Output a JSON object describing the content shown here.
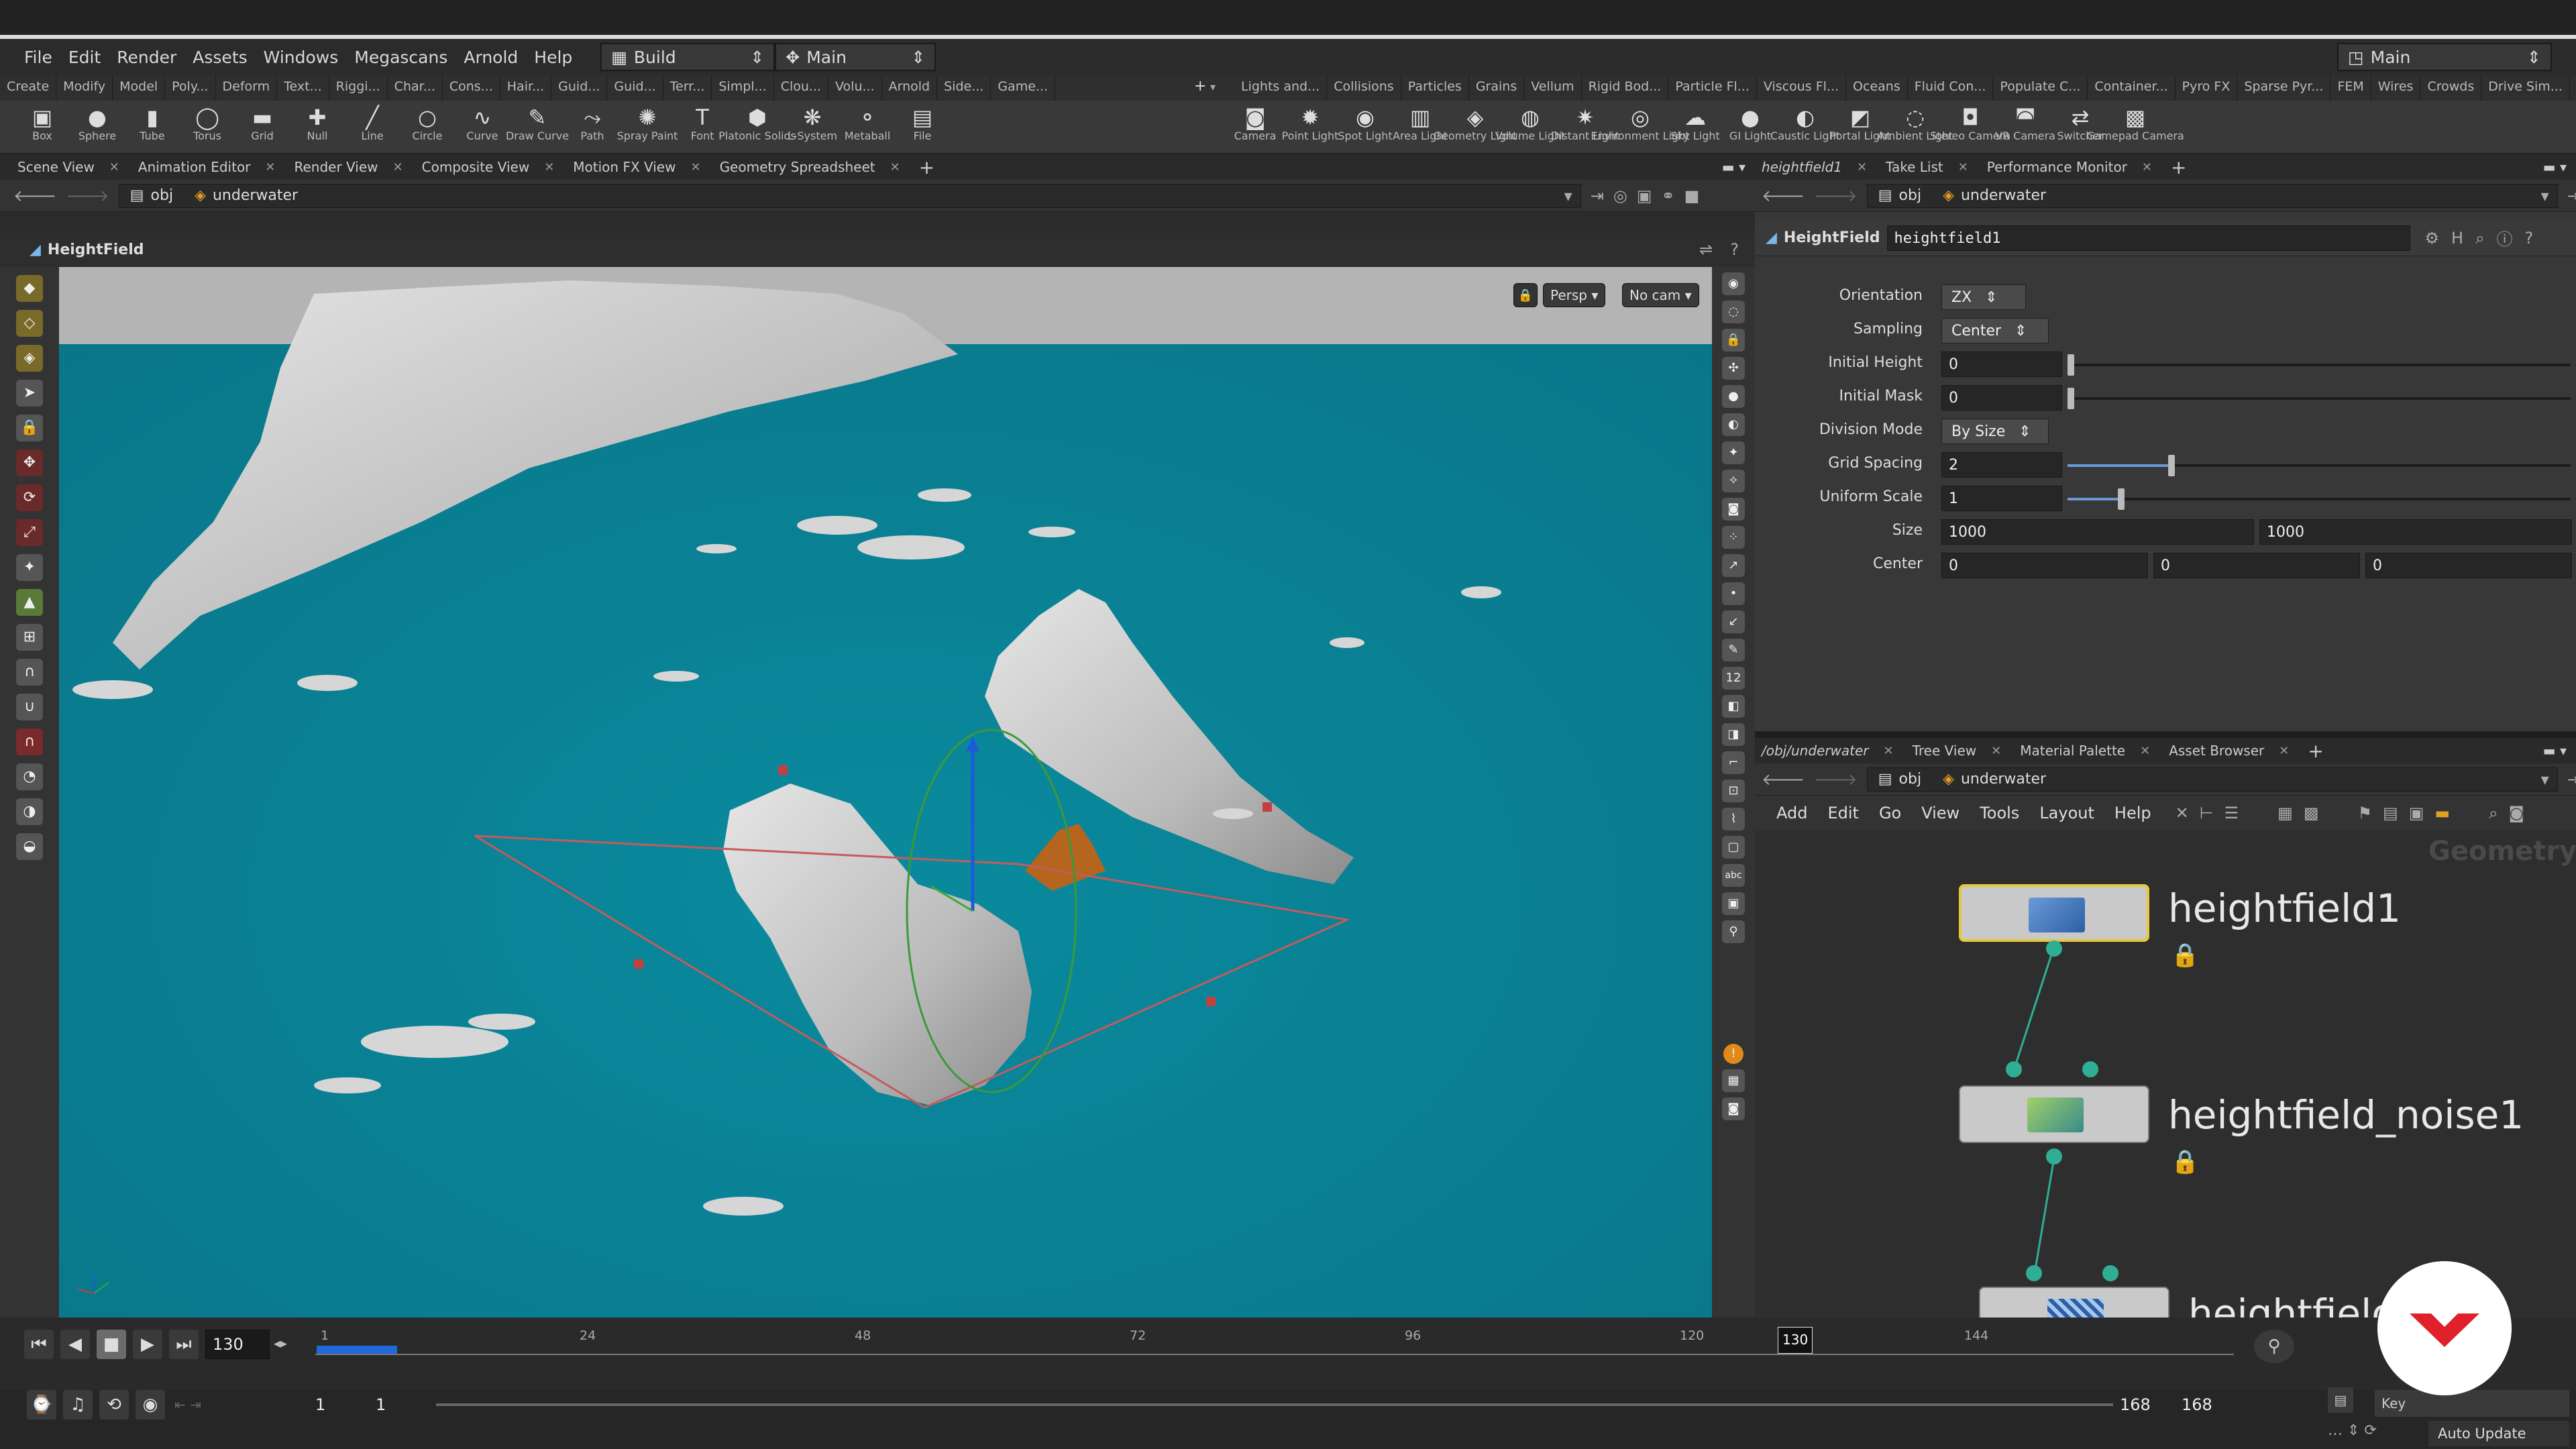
{
  "menubar": {
    "items": [
      "File",
      "Edit",
      "Render",
      "Assets",
      "Windows",
      "Megascans",
      "Arnold",
      "Help"
    ],
    "desktop": "Build",
    "context": "Main",
    "right_context": "Main"
  },
  "shelf_tabs_left": [
    "Create",
    "Modify",
    "Model",
    "Poly...",
    "Deform",
    "Text...",
    "Riggi...",
    "Char...",
    "Cons...",
    "Hair...",
    "Guid...",
    "Guid...",
    "Terr...",
    "Simpl...",
    "Clou...",
    "Volu...",
    "Arnold",
    "Side...",
    "Game..."
  ],
  "shelf_tabs_right": [
    "Lights and...",
    "Collisions",
    "Particles",
    "Grains",
    "Vellum",
    "Rigid Bod...",
    "Particle Fl...",
    "Viscous Fl...",
    "Oceans",
    "Fluid Con...",
    "Populate C...",
    "Container...",
    "Pyro FX",
    "Sparse Pyr...",
    "FEM",
    "Wires",
    "Crowds",
    "Drive Sim..."
  ],
  "shelf_tools_left": [
    {
      "label": "Box",
      "icon": "▣"
    },
    {
      "label": "Sphere",
      "icon": "●"
    },
    {
      "label": "Tube",
      "icon": "▮"
    },
    {
      "label": "Torus",
      "icon": "◯"
    },
    {
      "label": "Grid",
      "icon": "▬"
    },
    {
      "label": "Null",
      "icon": "✚"
    },
    {
      "label": "Line",
      "icon": "╱"
    },
    {
      "label": "Circle",
      "icon": "○"
    },
    {
      "label": "Curve",
      "icon": "∿"
    },
    {
      "label": "Draw Curve",
      "icon": "✎"
    },
    {
      "label": "Path",
      "icon": "⤳"
    },
    {
      "label": "Spray Paint",
      "icon": "✺"
    },
    {
      "label": "Font",
      "icon": "T"
    },
    {
      "label": "Platonic Solids",
      "icon": "⬢"
    },
    {
      "label": "L-System",
      "icon": "❋"
    },
    {
      "label": "Metaball",
      "icon": "⚬"
    },
    {
      "label": "File",
      "icon": "▤"
    }
  ],
  "shelf_tools_right": [
    {
      "label": "Camera",
      "icon": "◙"
    },
    {
      "label": "Point Light",
      "icon": "✹"
    },
    {
      "label": "Spot Light",
      "icon": "◉"
    },
    {
      "label": "Area Light",
      "icon": "▥"
    },
    {
      "label": "Geometry Light",
      "icon": "◈"
    },
    {
      "label": "Volume Light",
      "icon": "◍"
    },
    {
      "label": "Distant Light",
      "icon": "✷"
    },
    {
      "label": "Environment Light",
      "icon": "◎"
    },
    {
      "label": "Sky Light",
      "icon": "☁"
    },
    {
      "label": "GI Light",
      "icon": "●"
    },
    {
      "label": "Caustic Light",
      "icon": "◐"
    },
    {
      "label": "Portal Light",
      "icon": "◩"
    },
    {
      "label": "Ambient Light",
      "icon": "◌"
    },
    {
      "label": "Stereo Camera",
      "icon": "◘"
    },
    {
      "label": "VR Camera",
      "icon": "◚"
    },
    {
      "label": "Switcher",
      "icon": "⇄"
    },
    {
      "label": "Gamepad Camera",
      "icon": "▩"
    }
  ],
  "left_pane_tabs": [
    "Scene View",
    "Animation Editor",
    "Render View",
    "Composite View",
    "Motion FX View",
    "Geometry Spreadsheet"
  ],
  "left_path": {
    "root": "obj",
    "node": "underwater"
  },
  "viewport": {
    "title": "HeightField",
    "persp": "Persp ▾",
    "cam": "No cam ▾"
  },
  "param_tabs": [
    "heightfield1",
    "Take List",
    "Performance Monitor"
  ],
  "param_path": {
    "root": "obj",
    "node": "underwater"
  },
  "param_header": {
    "type": "HeightField",
    "name": "heightfield1"
  },
  "params": {
    "orientation": {
      "label": "Orientation",
      "value": "ZX"
    },
    "sampling": {
      "label": "Sampling",
      "value": "Center"
    },
    "initial_height": {
      "label": "Initial Height",
      "value": "0"
    },
    "initial_mask": {
      "label": "Initial Mask",
      "value": "0"
    },
    "division_mode": {
      "label": "Division Mode",
      "value": "By Size"
    },
    "grid_spacing": {
      "label": "Grid Spacing",
      "value": "2",
      "slider": 0.2
    },
    "uniform_scale": {
      "label": "Uniform Scale",
      "value": "1",
      "slider": 0.1
    },
    "size": {
      "label": "Size",
      "x": "1000",
      "y": "1000"
    },
    "center": {
      "label": "Center",
      "x": "0",
      "y": "0",
      "z": "0"
    }
  },
  "net_tabs": [
    "/obj/underwater",
    "Tree View",
    "Material Palette",
    "Asset Browser"
  ],
  "net_path": {
    "root": "obj",
    "node": "underwater"
  },
  "net_menu": [
    "Add",
    "Edit",
    "Go",
    "View",
    "Tools",
    "Layout",
    "Help"
  ],
  "net_context_label": "Geometry",
  "nodes": [
    {
      "name": "heightfield1"
    },
    {
      "name": "heightfield_noise1"
    },
    {
      "name": "heightfield..."
    }
  ],
  "timeline": {
    "current_frame": "130",
    "ticks": [
      "1",
      "24",
      "48",
      "72",
      "96",
      "120",
      "144"
    ],
    "marker": "130",
    "start": "1",
    "start2": "1",
    "end": "168",
    "end2": "168"
  },
  "status": {
    "auto_update": "Auto Update",
    "keys": "Key"
  },
  "colors": {
    "accent": "#f0c020",
    "node_wire": "#2fae95",
    "viewport_bg": "#087f92",
    "logo_red": "#e0202a"
  }
}
